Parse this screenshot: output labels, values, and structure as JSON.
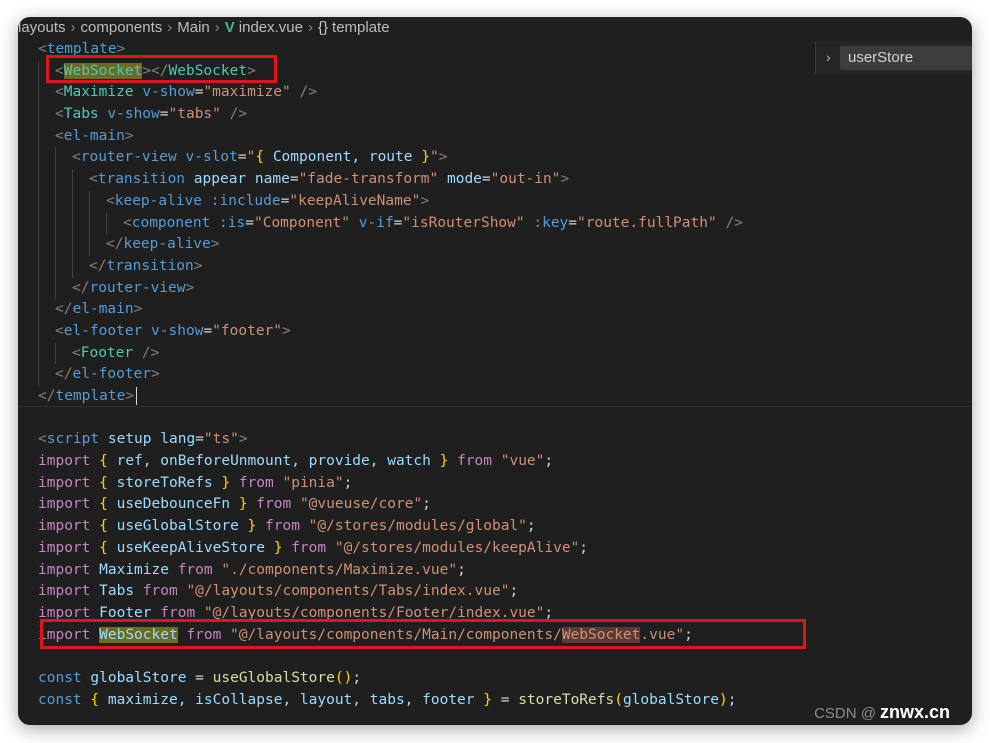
{
  "breadcrumb": {
    "items": [
      "layouts",
      "components",
      "Main",
      "index.vue",
      "template"
    ]
  },
  "find_widget": {
    "query": "userStore"
  },
  "code": {
    "template_open": "template",
    "websocket_tag": "WebSocket",
    "maximize": {
      "tag": "Maximize",
      "attr": "v-show",
      "value": "\"maximize\""
    },
    "tabs": {
      "tag": "Tabs",
      "attr": "v-show",
      "value": "\"tabs\""
    },
    "el_main": "el-main",
    "router_view": {
      "tag": "router-view",
      "attr": "v-slot",
      "value_open": "\"",
      "value_inner": " Component, route ",
      "value_close": "\""
    },
    "transition": {
      "tag": "transition",
      "a1": "appear",
      "a2": "name",
      "v2": "\"fade-transform\"",
      "a3": "mode",
      "v3": "\"out-in\""
    },
    "keep_alive": {
      "tag": "keep-alive",
      "attr": ":include",
      "value": "\"keepAliveName\""
    },
    "component": {
      "tag": "component",
      "a1": ":is",
      "v1": "\"Component\"",
      "a2": "v-if",
      "v2": "\"isRouterShow\"",
      "a3": ":key",
      "v3": "\"route.fullPath\""
    },
    "keep_alive_close": "keep-alive",
    "transition_close": "transition",
    "router_view_close": "router-view",
    "el_main_close": "el-main",
    "el_footer": {
      "tag": "el-footer",
      "attr": "v-show",
      "value": "\"footer\""
    },
    "footer_tag": "Footer",
    "el_footer_close": "el-footer",
    "template_close": "template",
    "script": {
      "tag": "script",
      "a1": "setup",
      "a2": "lang",
      "v2": "\"ts\""
    },
    "imports": [
      {
        "names": "ref, onBeforeUnmount, provide, watch",
        "from": "\"vue\""
      },
      {
        "names": "storeToRefs",
        "from": "\"pinia\""
      },
      {
        "names": "useDebounceFn",
        "from": "\"@vueuse/core\""
      },
      {
        "names": "useGlobalStore",
        "from": "\"@/stores/modules/global\""
      },
      {
        "names": "useKeepAliveStore",
        "from": "\"@/stores/modules/keepAlive\""
      }
    ],
    "default_imports": [
      {
        "name": "Maximize",
        "from": "\"./components/Maximize.vue\""
      },
      {
        "name": "Tabs",
        "from": "\"@/layouts/components/Tabs/index.vue\""
      },
      {
        "name": "Footer",
        "from": "\"@/layouts/components/Footer/index.vue\""
      }
    ],
    "websocket_import": {
      "name": "WebSocket",
      "path_a": "\"@/layouts/components/Main/components/",
      "path_b": "WebSocket",
      "path_c": ".vue\""
    },
    "global_store_line": {
      "kw": "const",
      "name": "globalStore",
      "fn": "useGlobalStore"
    },
    "refs_line": {
      "kw": "const",
      "names": "maximize, isCollapse, layout, tabs, footer",
      "fn": "storeToRefs",
      "arg": "globalStore"
    }
  },
  "watermark": {
    "left": "CSDN @",
    "right": "znwx.cn"
  }
}
